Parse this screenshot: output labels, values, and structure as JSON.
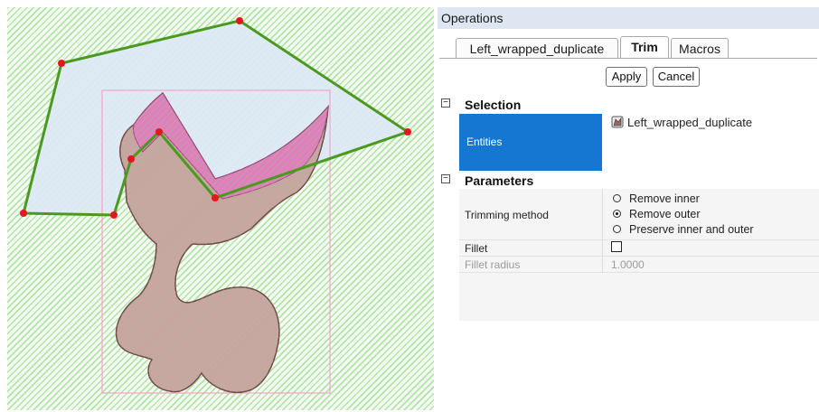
{
  "viewport": {
    "pattern_color": "#b4e3a8",
    "region_fill": "#dde8f6",
    "polyline_color": "#4a9a1f",
    "vertex_color": "#e8141e",
    "bbox_color": "#f2a3c8",
    "model_skin": "#c9a0a0",
    "model_cut": "#e07fbd"
  },
  "operations": {
    "title": "Operations",
    "tabs": [
      {
        "label": "Left_wrapped_duplicate",
        "active": false
      },
      {
        "label": "Trim",
        "active": true
      },
      {
        "label": "Macros",
        "active": false
      }
    ],
    "apply_label": "Apply",
    "cancel_label": "Cancel",
    "selection": {
      "header": "Selection",
      "entities_label": "Entities",
      "entities_value": "Left_wrapped_duplicate",
      "entity_icon": "mesh-object-icon",
      "toggle": "⊟"
    },
    "parameters": {
      "header": "Parameters",
      "toggle": "⊟",
      "trimming_method_label": "Trimming method",
      "options": [
        {
          "label": "Remove inner",
          "selected": false
        },
        {
          "label": "Remove outer",
          "selected": true
        },
        {
          "label": "Preserve inner and outer",
          "selected": false
        }
      ],
      "fillet_label": "Fillet",
      "fillet_checked": false,
      "fillet_radius_label": "Fillet radius",
      "fillet_radius_value": "1.0000"
    },
    "colors": {
      "title_bar": "#dde6f1",
      "selected_cell": "#1677d2"
    }
  }
}
